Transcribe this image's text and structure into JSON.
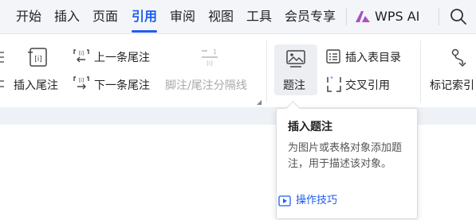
{
  "tabs": [
    {
      "label": "开始"
    },
    {
      "label": "插入"
    },
    {
      "label": "页面"
    },
    {
      "label": "引用",
      "active": true
    },
    {
      "label": "审阅"
    },
    {
      "label": "视图"
    },
    {
      "label": "工具"
    },
    {
      "label": "会员专享"
    }
  ],
  "ai_button": {
    "label": "WPS AI",
    "icon": "wps-ai-logo-icon"
  },
  "search": {
    "icon": "search-icon"
  },
  "ribbon": {
    "insert_endnote": "插入尾注",
    "prev_endnote": "上一条尾注",
    "next_endnote": "下一条尾注",
    "footnote_separator": "脚注/尾注分隔线",
    "caption": "题注",
    "insert_table_of_figures": "插入表目录",
    "cross_reference": "交叉引用",
    "mark_index": "标记索引"
  },
  "tooltip": {
    "title": "插入题注",
    "description": "为图片或表格对象添加题注，用于描述该对象。",
    "link": "操作技巧"
  },
  "colors": {
    "accent": "#1f5cf0",
    "tab_bar_bg": "#f3f5f9",
    "disabled_text": "#a8a8a8"
  }
}
